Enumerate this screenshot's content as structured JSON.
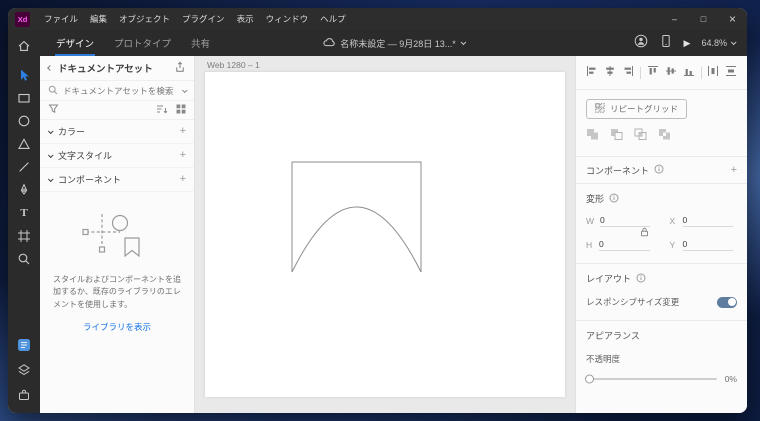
{
  "titlebar": {
    "logo": "Xd",
    "menus": [
      "ファイル",
      "編集",
      "オブジェクト",
      "プラグイン",
      "表示",
      "ウィンドウ",
      "ヘルプ"
    ],
    "window_controls": {
      "minimize": "–",
      "maximize": "□",
      "close": "×"
    }
  },
  "header": {
    "tabs": [
      {
        "label": "デザイン"
      },
      {
        "label": "プロトタイプ"
      },
      {
        "label": "共有"
      }
    ],
    "doc_title": "名称未設定 — 9月28日 13...*",
    "zoom_level": "64.8%",
    "play_glyph": "▶"
  },
  "toolbar": {
    "tools": [
      "home",
      "select",
      "rectangle",
      "ellipse",
      "polygon",
      "line",
      "pen",
      "text",
      "artboard",
      "zoom"
    ],
    "text_tool_glyph": "T",
    "bottom": [
      "libraries",
      "layers",
      "plugins"
    ]
  },
  "left_panel": {
    "title": "ドキュメントアセット",
    "search_placeholder": "ドキュメントアセットを検索",
    "sections": [
      {
        "label": "カラー"
      },
      {
        "label": "文字スタイル"
      },
      {
        "label": "コンポーネント"
      }
    ],
    "empty_text": "スタイルおよびコンポーネントを追加するか、既存のライブラリのエレメントを使用します。",
    "library_link": "ライブラリを表示"
  },
  "canvas": {
    "artboard_label": "Web 1280 – 1"
  },
  "right_panel": {
    "repeat_grid_label": "リピートグリッド",
    "component_label": "コンポーネント",
    "transform_label": "変形",
    "transform_fields": [
      {
        "label": "W",
        "value": "0"
      },
      {
        "label": "X",
        "value": "0"
      },
      {
        "label": "H",
        "value": "0"
      },
      {
        "label": "Y",
        "value": "0"
      }
    ],
    "layout_label": "レイアウト",
    "responsive_resize_label": "レスポンシブサイズ変更",
    "responsive_resize_on": true,
    "appearance_label": "アピアランス",
    "opacity_label": "不透明度",
    "opacity_value": "0%"
  },
  "glyphs": {
    "plus": "+"
  },
  "colors": {
    "dark_ui": "#2b2b2b",
    "accent_blue": "#2e7cd6",
    "link_blue": "#1473e6",
    "xd_logo_bg": "#470137",
    "xd_logo_fg": "#ff61f6"
  }
}
